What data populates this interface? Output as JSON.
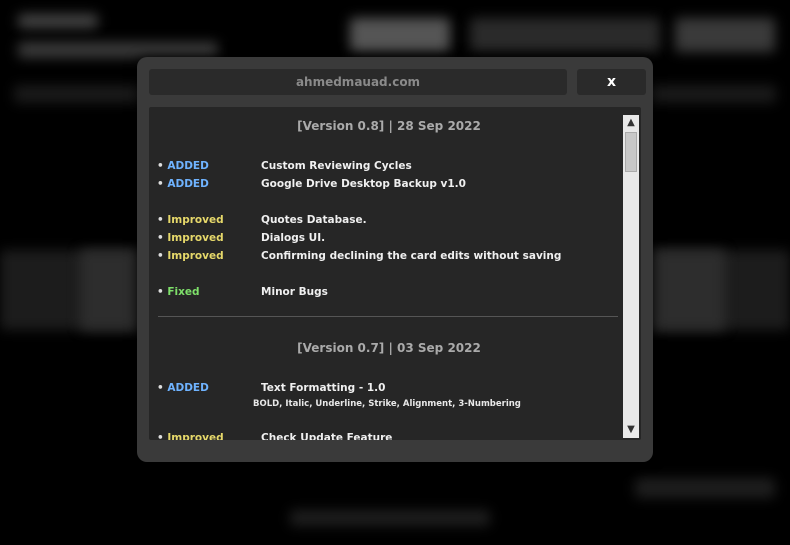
{
  "dialog": {
    "title": "ahmedmauad.com",
    "close_label": "x"
  },
  "releases": [
    {
      "header": "[Version 0.8] | 28 Sep 2022",
      "items": [
        {
          "tag": "ADDED",
          "kind": "added",
          "text": "Custom Reviewing Cycles"
        },
        {
          "tag": "ADDED",
          "kind": "added",
          "text": "Google Drive Desktop Backup v1.0"
        },
        {
          "tag": "Improved",
          "kind": "improved",
          "text": "Quotes Database."
        },
        {
          "tag": "Improved",
          "kind": "improved",
          "text": "Dialogs UI."
        },
        {
          "tag": "Improved",
          "kind": "improved",
          "text": "Confirming declining the card edits without saving"
        },
        {
          "tag": "Fixed",
          "kind": "fixed",
          "text": "Minor Bugs"
        }
      ]
    },
    {
      "header": "[Version 0.7] | 03 Sep 2022",
      "items": [
        {
          "tag": "ADDED",
          "kind": "added",
          "text": "Text Formatting - 1.0",
          "sub": "BOLD, Italic, Underline, Strike, Alignment, 3-Numbering"
        },
        {
          "tag": "Improved",
          "kind": "improved",
          "text": "Check Update Feature"
        }
      ]
    }
  ],
  "bullet": "•",
  "colors": {
    "added": "#6fb3ff",
    "improved": "#e6d86a",
    "fixed": "#7ee06a"
  },
  "scrollbar": {
    "up_icon": "chevron-up-icon",
    "down_icon": "chevron-down-icon"
  }
}
